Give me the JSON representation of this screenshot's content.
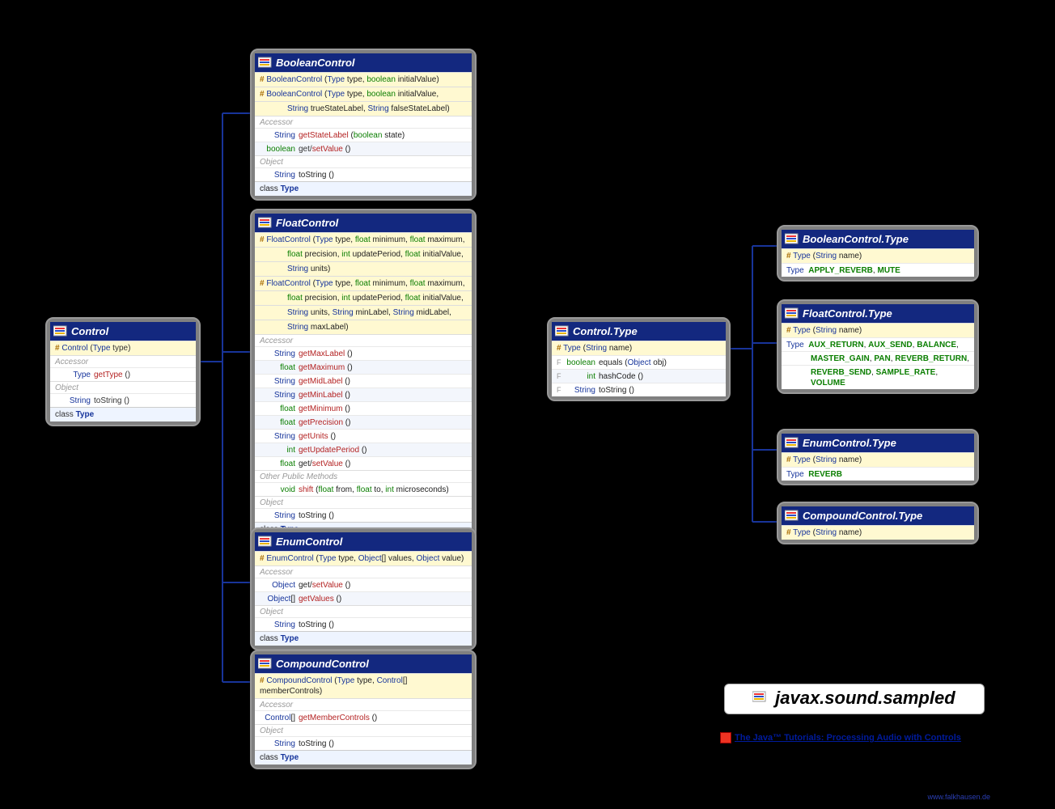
{
  "package": "javax.sound.sampled",
  "tutorial_link": "The Java™ Tutorials: Processing Audio with Controls",
  "credit": "www.falkhausen.de",
  "control": {
    "title": "Control",
    "ctor": "# Control (Type type)",
    "sect_acc": "Accessor",
    "r_getType": "Type  getType ()",
    "sect_obj": "Object",
    "r_toString": "String  toString ()",
    "inner": "class Type"
  },
  "booleanControl": {
    "title": "BooleanControl",
    "c1": "# BooleanControl (Type type, boolean initialValue)",
    "c2a": "# BooleanControl (Type type, boolean initialValue,",
    "c2b": "String trueStateLabel, String falseStateLabel)",
    "sect_acc": "Accessor",
    "r1": "String  getStateLabel (boolean state)",
    "r2": "boolean  get/setValue ()",
    "sect_obj": "Object",
    "r3": "String  toString ()",
    "inner": "class Type"
  },
  "floatControl": {
    "title": "FloatControl",
    "c1a": "# FloatControl (Type type, float minimum, float maximum,",
    "c1b": "float precision, int updatePeriod, float initialValue,",
    "c1c": "String units)",
    "c2a": "# FloatControl (Type type, float minimum, float maximum,",
    "c2b": "float precision, int updatePeriod, float initialValue,",
    "c2c": "String units, String minLabel, String midLabel,",
    "c2d": "String maxLabel)",
    "sect_acc": "Accessor",
    "r1": "String  getMaxLabel ()",
    "r2": "float  getMaximum ()",
    "r3": "String  getMidLabel ()",
    "r4": "String  getMinLabel ()",
    "r5": "float  getMinimum ()",
    "r6": "float  getPrecision ()",
    "r7": "String  getUnits ()",
    "r8": "int  getUpdatePeriod ()",
    "r9": "float  get/setValue ()",
    "sect_other": "Other Public Methods",
    "r10": "void  shift (float from, float to, int microseconds)",
    "sect_obj": "Object",
    "r11": "String  toString ()",
    "inner": "class Type"
  },
  "enumControl": {
    "title": "EnumControl",
    "c1": "# EnumControl (Type type, Object[] values, Object value)",
    "sect_acc": "Accessor",
    "r1": "Object  get/setValue ()",
    "r2": "Object[]  getValues ()",
    "sect_obj": "Object",
    "r3": "String  toString ()",
    "inner": "class Type"
  },
  "compoundControl": {
    "title": "CompoundControl",
    "c1": "# CompoundControl (Type type, Control[] memberControls)",
    "sect_acc": "Accessor",
    "r1": "Control[]  getMemberControls ()",
    "sect_obj": "Object",
    "r2": "String  toString ()",
    "inner": "class Type"
  },
  "controlType": {
    "title": "Control.Type",
    "c1": "# Type (String name)",
    "r1_mod": "F",
    "r1": "boolean  equals (Object obj)",
    "r2_mod": "F",
    "r2": "int  hashCode ()",
    "r3_mod": "F",
    "r3": "String  toString ()"
  },
  "booleanType": {
    "title": "BooleanControl.Type",
    "c1": "# Type (String name)",
    "consts": "Type  APPLY_REVERB, MUTE"
  },
  "floatType": {
    "title": "FloatControl.Type",
    "c1": "# Type (String name)",
    "l1": "Type  AUX_RETURN, AUX_SEND, BALANCE,",
    "l2": "MASTER_GAIN, PAN, REVERB_RETURN,",
    "l3": "REVERB_SEND, SAMPLE_RATE, VOLUME"
  },
  "enumType": {
    "title": "EnumControl.Type",
    "c1": "# Type (String name)",
    "consts": "Type  REVERB"
  },
  "compoundType": {
    "title": "CompoundControl.Type",
    "c1": "# Type (String name)"
  }
}
